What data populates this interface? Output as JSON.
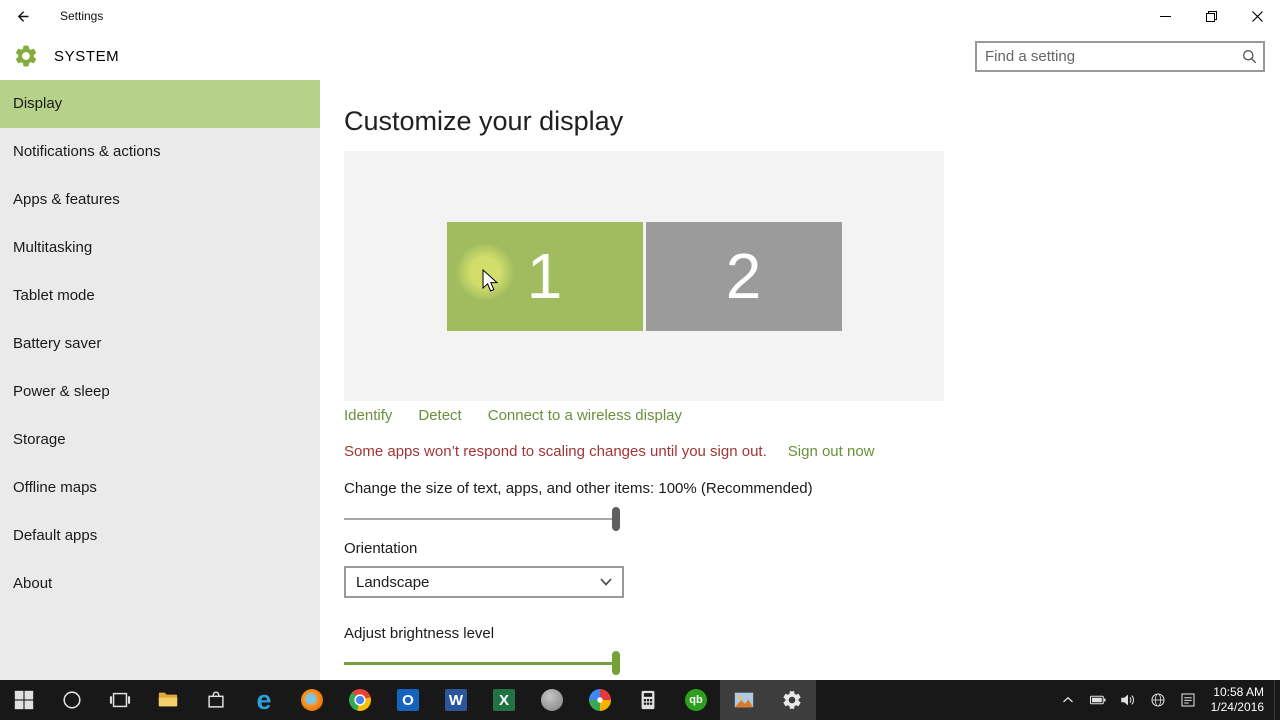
{
  "titlebar": {
    "title": "Settings"
  },
  "header": {
    "app_title": "SYSTEM",
    "search_placeholder": "Find a setting"
  },
  "sidebar": {
    "items": [
      {
        "label": "Display",
        "selected": true
      },
      {
        "label": "Notifications & actions"
      },
      {
        "label": "Apps & features"
      },
      {
        "label": "Multitasking"
      },
      {
        "label": "Tablet mode"
      },
      {
        "label": "Battery saver"
      },
      {
        "label": "Power & sleep"
      },
      {
        "label": "Storage"
      },
      {
        "label": "Offline maps"
      },
      {
        "label": "Default apps"
      },
      {
        "label": "About"
      }
    ]
  },
  "main": {
    "heading": "Customize your display",
    "monitors": [
      {
        "number": "1"
      },
      {
        "number": "2"
      }
    ],
    "links": {
      "identify": "Identify",
      "detect": "Detect",
      "wireless": "Connect to a wireless display"
    },
    "warning": "Some apps won’t respond to scaling changes until you sign out.",
    "sign_out": "Sign out now",
    "scale_label": "Change the size of text, apps, and other items: 100% (Recommended)",
    "scale_value": "100%",
    "orientation_label": "Orientation",
    "orientation_value": "Landscape",
    "brightness_label": "Adjust brightness level"
  },
  "taskbar": {
    "glyphs": {
      "edge": "e",
      "outlook": "O",
      "word": "W",
      "excel": "X",
      "quickbooks": "qb"
    },
    "clock": {
      "time": "10:58 AM",
      "date": "1/24/2016"
    }
  },
  "colors": {
    "accent_green": "#76a038",
    "link_green": "#6a903c",
    "sidebar_selected": "#b6d189",
    "monitor_active": "#a0bc5f",
    "monitor_inactive": "#9b9b9b",
    "warning_red": "#a23535",
    "taskbar_bg": "#181818"
  }
}
